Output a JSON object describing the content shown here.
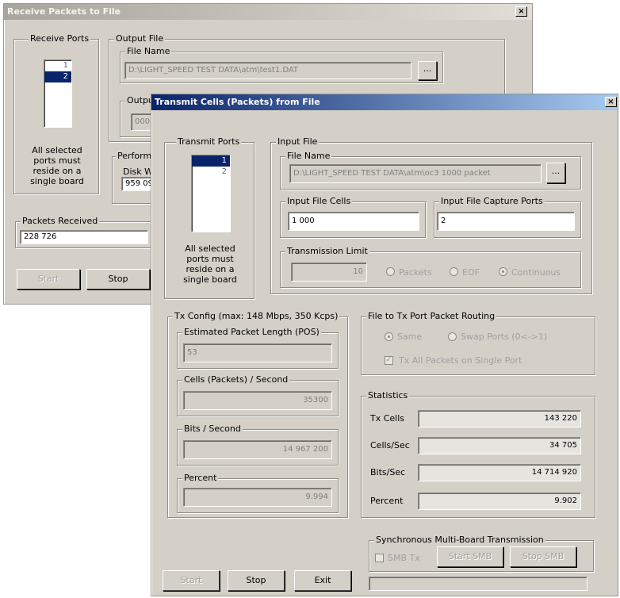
{
  "receive": {
    "title": "Receive Packets to File",
    "close": "×",
    "ports_group": "Receive Ports",
    "ports": [
      "1",
      "2"
    ],
    "ports_note": "All selected ports must reside on a single board",
    "output_group": "Output File",
    "file_name_label": "File Name",
    "file_name_value": "D:\\LIGHT_SPEED TEST DATA\\atm\\test1.DAT",
    "browse": "...",
    "output_trunc_label": "Outpu",
    "output_trunc_value": "000",
    "perf_trunc_label": "Perform",
    "disk_trunc_label": "Disk Wr",
    "disk_trunc_value": "959 09",
    "packets_received_label": "Packets Received",
    "packets_received_value": "228 726",
    "start": "Start",
    "stop": "Stop"
  },
  "transmit": {
    "title": "Transmit Cells (Packets) from File",
    "close": "×",
    "ports_group": "Transmit Ports",
    "ports": [
      "1",
      "2"
    ],
    "ports_note": "All selected ports must reside on a single board",
    "input_group": "Input File",
    "file_name_label": "File Name",
    "file_name_value": "D:\\LIGHT_SPEED TEST DATA\\atm\\oc3 1000 packet",
    "browse": "...",
    "cells_label": "Input File Cells",
    "cells_value": "1 000",
    "capture_label": "Input File Capture Ports",
    "capture_value": "2",
    "limit_group": "Transmission Limit",
    "limit_value": "10",
    "limit_options": [
      "Packets",
      "EOF",
      "Continuous"
    ],
    "txcfg_group": "Tx Config (max: 148 Mbps, 350 Kcps)",
    "est_len_label": "Estimated Packet Length (POS)",
    "est_len_value": "53",
    "cps_label": "Cells (Packets) / Second",
    "cps_value": "35300",
    "bps_label": "Bits / Second",
    "bps_value": "14 967 200",
    "pct_label": "Percent",
    "pct_value": "9.994",
    "routing_group": "File to Tx Port Packet Routing",
    "routing_same": "Same",
    "routing_swap": "Swap Ports (0<->1)",
    "routing_single": "Tx All Packets on Single Port",
    "stats_group": "Statistics",
    "stats": [
      {
        "label": "Tx Cells",
        "value": "143 220"
      },
      {
        "label": "Cells/Sec",
        "value": "34 705"
      },
      {
        "label": "Bits/Sec",
        "value": "14 714 920"
      },
      {
        "label": "Percent",
        "value": "9.902"
      }
    ],
    "smb_group": "Synchronous Multi-Board Transmission",
    "smb_tx": "SMB Tx",
    "smb_start": "Start SMB",
    "smb_stop": "Stop SMB",
    "start": "Start",
    "stop": "Stop",
    "exit": "Exit"
  }
}
